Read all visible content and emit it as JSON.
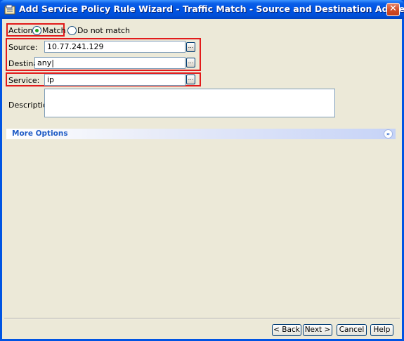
{
  "window": {
    "title": "Add Service Policy Rule Wizard - Traffic Match - Source and Destination Address",
    "close_glyph": "✕"
  },
  "action": {
    "label": "Action:",
    "options": [
      {
        "label": "Match",
        "selected": true
      },
      {
        "label": "Do not match",
        "selected": false
      }
    ]
  },
  "source": {
    "label": "Source:",
    "value": "10.77.241.129",
    "browse": "..."
  },
  "destination": {
    "label": "Destination",
    "value": "any",
    "browse": "..."
  },
  "service": {
    "label": "Service:",
    "value": "ip",
    "browse": "..."
  },
  "description": {
    "label": "Description:",
    "value": ""
  },
  "more_options": {
    "label": "More Options",
    "chevron_icon": "double-chevron-down-icon"
  },
  "buttons": {
    "back": "< Back",
    "next": "Next >",
    "cancel": "Cancel",
    "help": "Help"
  },
  "colors": {
    "highlight": "#E21B1B",
    "title_bar": "#0055E5",
    "client_bg": "#ECE9D8",
    "link_blue": "#215DC6"
  }
}
